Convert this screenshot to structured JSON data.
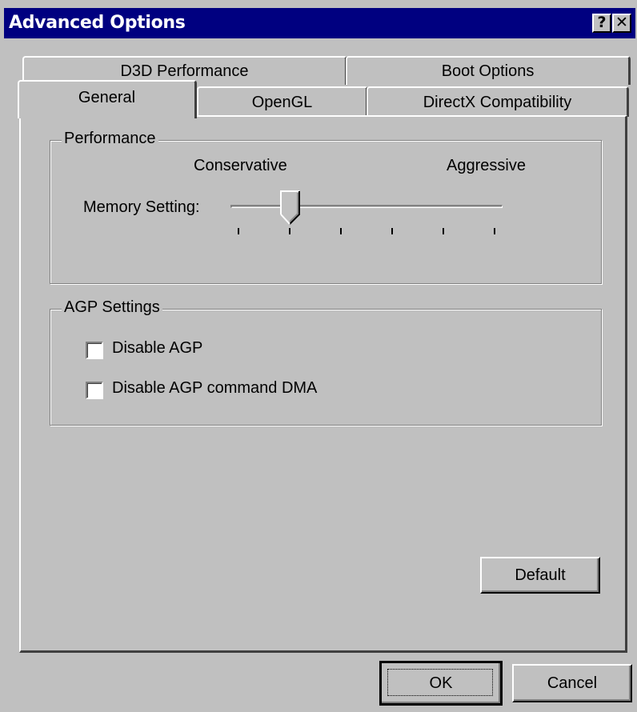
{
  "window": {
    "title": "Advanced Options"
  },
  "title_buttons": {
    "help": "?",
    "close": "✕"
  },
  "tabs": {
    "row_back": [
      "D3D Performance",
      "Boot Options"
    ],
    "row_front": [
      "General",
      "OpenGL",
      "DirectX Compatibility"
    ],
    "selected": "General"
  },
  "performance": {
    "title": "Performance",
    "left_label": "Conservative",
    "right_label": "Aggressive",
    "memory_label": "Memory Setting:",
    "slider": {
      "positions": 6,
      "selected_index": 1
    }
  },
  "agp": {
    "title": "AGP Settings",
    "options": [
      {
        "label": "Disable AGP",
        "checked": false
      },
      {
        "label": "Disable AGP command DMA",
        "checked": false
      }
    ]
  },
  "buttons": {
    "default": "Default",
    "ok": "OK",
    "cancel": "Cancel"
  }
}
